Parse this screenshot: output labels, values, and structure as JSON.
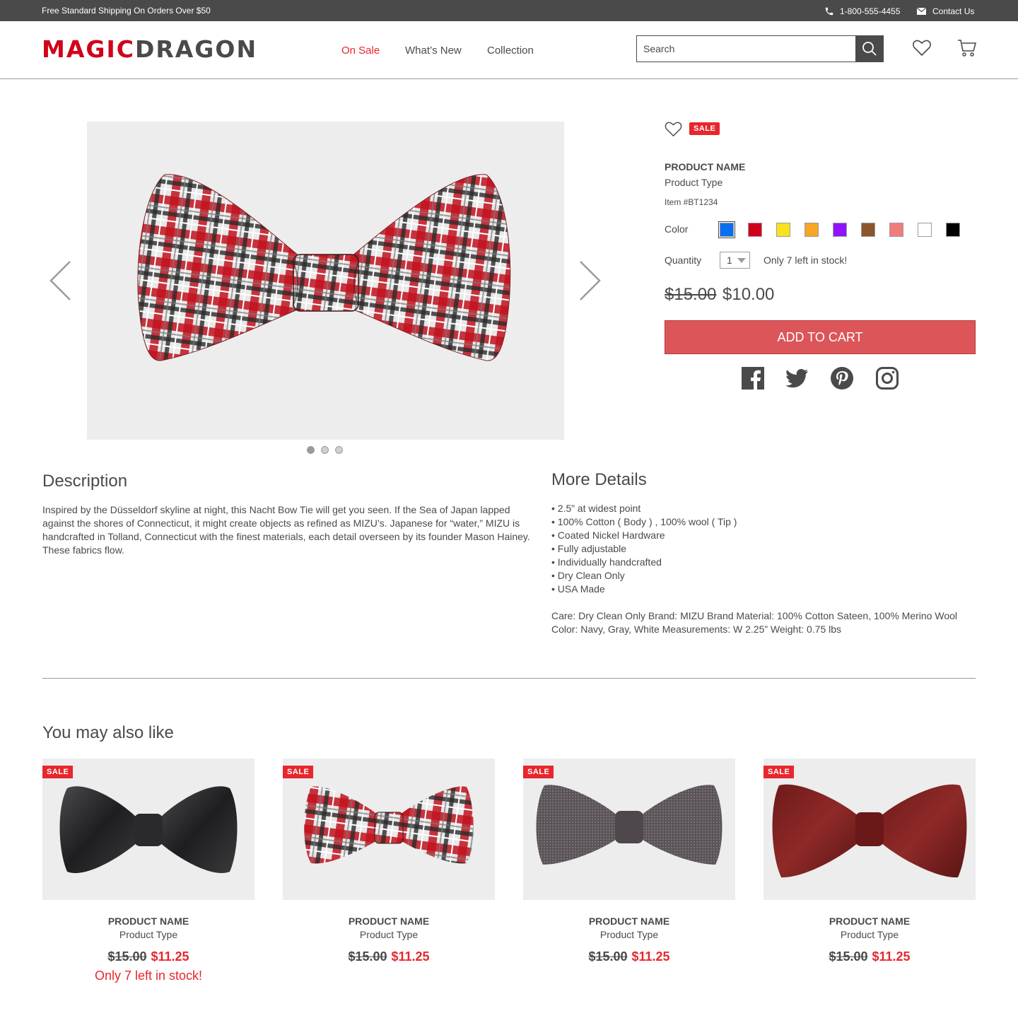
{
  "topbar": {
    "promo": "Free Standard Shipping On Orders Over $50",
    "phone": "1-800-555-4455",
    "contact": "Contact Us"
  },
  "header": {
    "logo_part1": "MAGIC",
    "logo_part2": "DRAGON",
    "nav": [
      "On Sale",
      "What’s New",
      "Collection"
    ],
    "active_nav": "On Sale",
    "search_placeholder": "Search"
  },
  "icons": {
    "search": "search-icon",
    "wishlist": "heart-icon",
    "cart": "cart-icon",
    "phone": "phone-icon",
    "mail": "mail-icon",
    "prev": "chevron-left-icon",
    "next": "chevron-right-icon"
  },
  "gallery": {
    "slides": 3,
    "active_slide": 1
  },
  "product": {
    "badge": "SALE",
    "name": "PRODUCT NAME",
    "type": "Product Type",
    "item": "Item #BT1234",
    "color_label": "Color",
    "colors": [
      "#0a6ef0",
      "#d0021b",
      "#f8e21c",
      "#f5a623",
      "#9013fe",
      "#8b572a",
      "#f07d7d",
      "#ffffff",
      "#000000"
    ],
    "selected_color": "#0a6ef0",
    "quantity_label": "Quantity",
    "quantity": "1",
    "stock": "Only 7 left in stock!",
    "price_old": "$15.00",
    "price_new": "$10.00",
    "add_to_cart": "ADD TO CART",
    "social": [
      "facebook-icon",
      "twitter-icon",
      "pinterest-icon",
      "instagram-icon"
    ]
  },
  "description": {
    "title": "Description",
    "text": "Inspired by the Düsseldorf skyline at night, this Nacht Bow Tie will get you seen. If the Sea of Japan lapped against the shores of Connecticut, it might create objects as refined as MIZU’s. Japanese for “water,” MIZU is handcrafted in Tolland, Connecticut with the finest materials, each detail overseen by its founder Mason Hainey. These fabrics flow."
  },
  "details": {
    "title": "More Details",
    "items": [
      "• 2.5” at widest point",
      "• 100% Cotton ( Body ) , 100% wool ( Tip )",
      "• Coated Nickel Hardware",
      "• Fully adjustable",
      "• Individually handcrafted",
      "• Dry Clean Only",
      "• USA Made"
    ],
    "care": "Care: Dry Clean Only  Brand: MIZU Brand Material: 100% Cotton Sateen, 100% Merino Wool Color: Navy, Gray, White Measurements: W 2.25”  Weight: 0.75 lbs"
  },
  "related": {
    "title": "You may also like",
    "items": [
      {
        "badge": "SALE",
        "name": "PRODUCT NAME",
        "type": "Product Type",
        "price_old": "$15.00",
        "price_new": "$11.25",
        "stock": "Only 7 left in stock!",
        "style": "black"
      },
      {
        "badge": "SALE",
        "name": "PRODUCT NAME",
        "type": "Product Type",
        "price_old": "$15.00",
        "price_new": "$11.25",
        "stock": "",
        "style": "plaid"
      },
      {
        "badge": "SALE",
        "name": "PRODUCT NAME",
        "type": "Product Type",
        "price_old": "$15.00",
        "price_new": "$11.25",
        "stock": "",
        "style": "gray"
      },
      {
        "badge": "SALE",
        "name": "PRODUCT NAME",
        "type": "Product Type",
        "price_old": "$15.00",
        "price_new": "$11.25",
        "stock": "",
        "style": "maroon"
      }
    ]
  }
}
